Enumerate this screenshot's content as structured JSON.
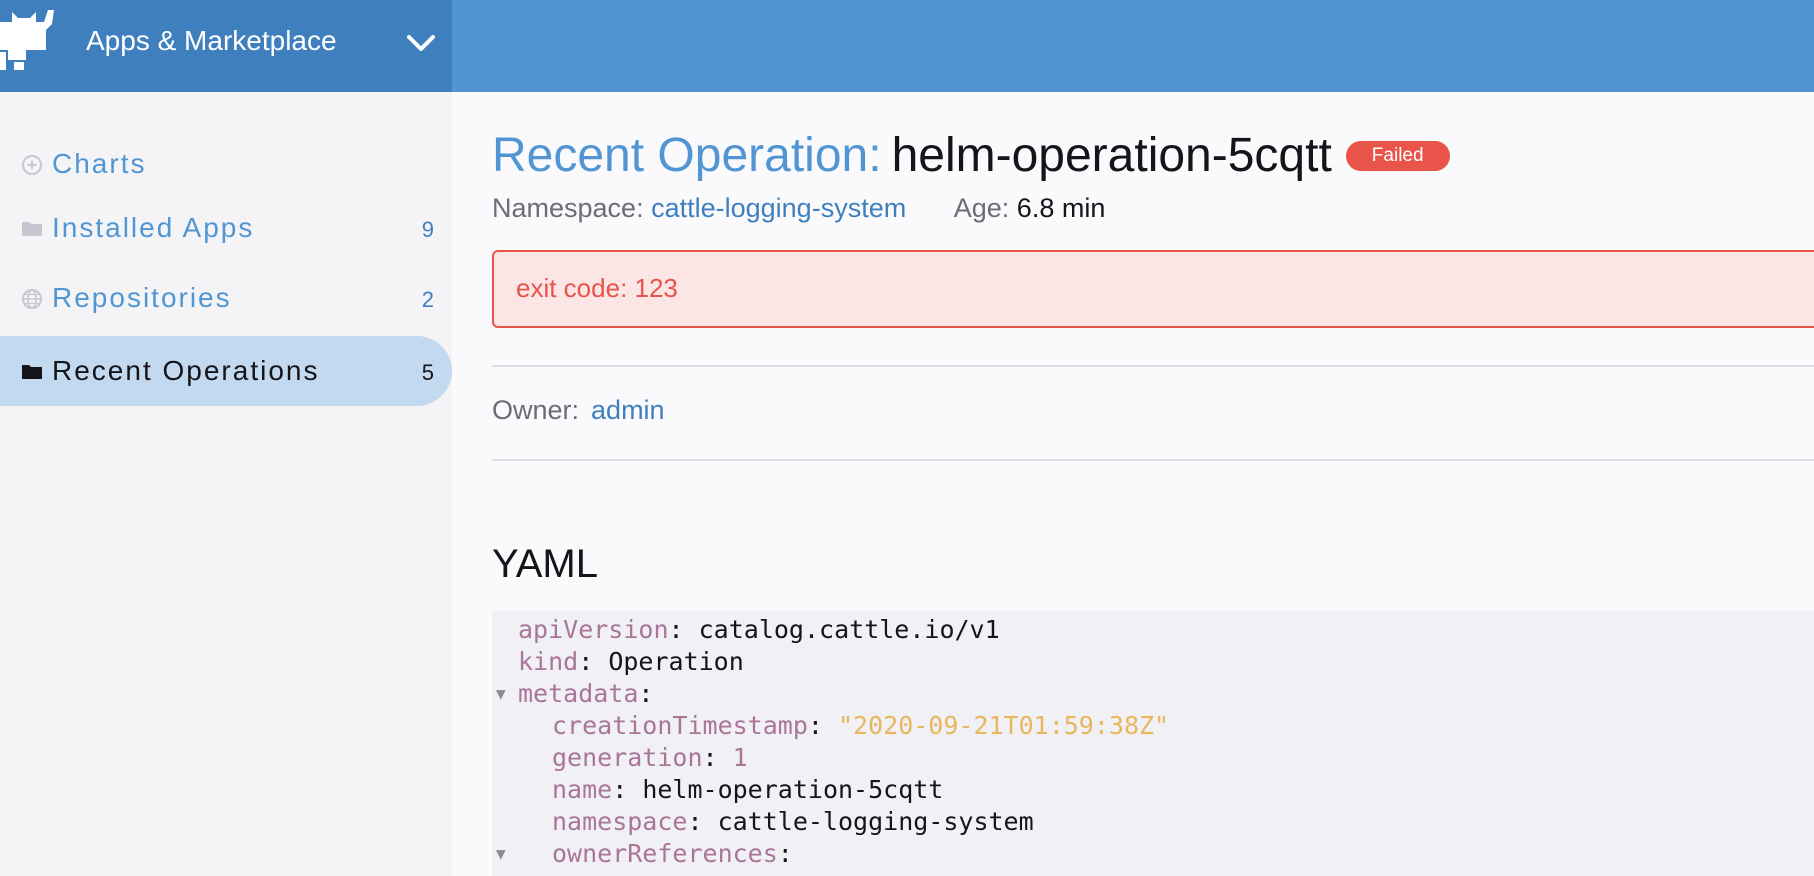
{
  "header": {
    "app_title": "Apps & Marketplace",
    "logo_icon": "cow-logo-icon",
    "dropdown_icon": "chevron-down-icon"
  },
  "sidebar": {
    "items": [
      {
        "label": "Charts",
        "count": "",
        "icon": "plus-circle-icon"
      },
      {
        "label": "Installed Apps",
        "count": "9",
        "icon": "folder-icon"
      },
      {
        "label": "Repositories",
        "count": "2",
        "icon": "globe-icon"
      },
      {
        "label": "Recent Operations",
        "count": "5",
        "icon": "folder-icon",
        "active": true
      }
    ]
  },
  "main": {
    "title_prefix": "Recent Operation:",
    "title_name": "helm-operation-5cqtt",
    "status_badge": "Failed",
    "namespace_label": "Namespace:",
    "namespace_value": "cattle-logging-system",
    "age_label": "Age:",
    "age_value": "6.8 min",
    "error_message": "exit code: 123",
    "owner_label": "Owner:",
    "owner_value": "admin",
    "yaml_title": "YAML",
    "yaml_lines": [
      {
        "key": "apiVersion",
        "value": "catalog.cattle.io/v1",
        "type": "string"
      },
      {
        "key": "kind",
        "value": "Operation",
        "type": "string"
      },
      {
        "key": "metadata",
        "value": "",
        "type": "object"
      },
      {
        "key": "creationTimestamp",
        "value": "\"2020-09-21T01:59:38Z\"",
        "type": "quoted"
      },
      {
        "key": "generation",
        "value": "1",
        "type": "number"
      },
      {
        "key": "name",
        "value": "helm-operation-5cqtt",
        "type": "string"
      },
      {
        "key": "namespace",
        "value": "cattle-logging-system",
        "type": "string"
      },
      {
        "key": "ownerReferences",
        "value": "",
        "type": "object"
      }
    ]
  },
  "colors": {
    "header_left": "#3f7fbd",
    "header_right": "#5196d3",
    "link": "#3f7fbd",
    "error": "#e8534a",
    "yaml_key": "#a9769a",
    "yaml_quoted": "#e8b75c"
  }
}
